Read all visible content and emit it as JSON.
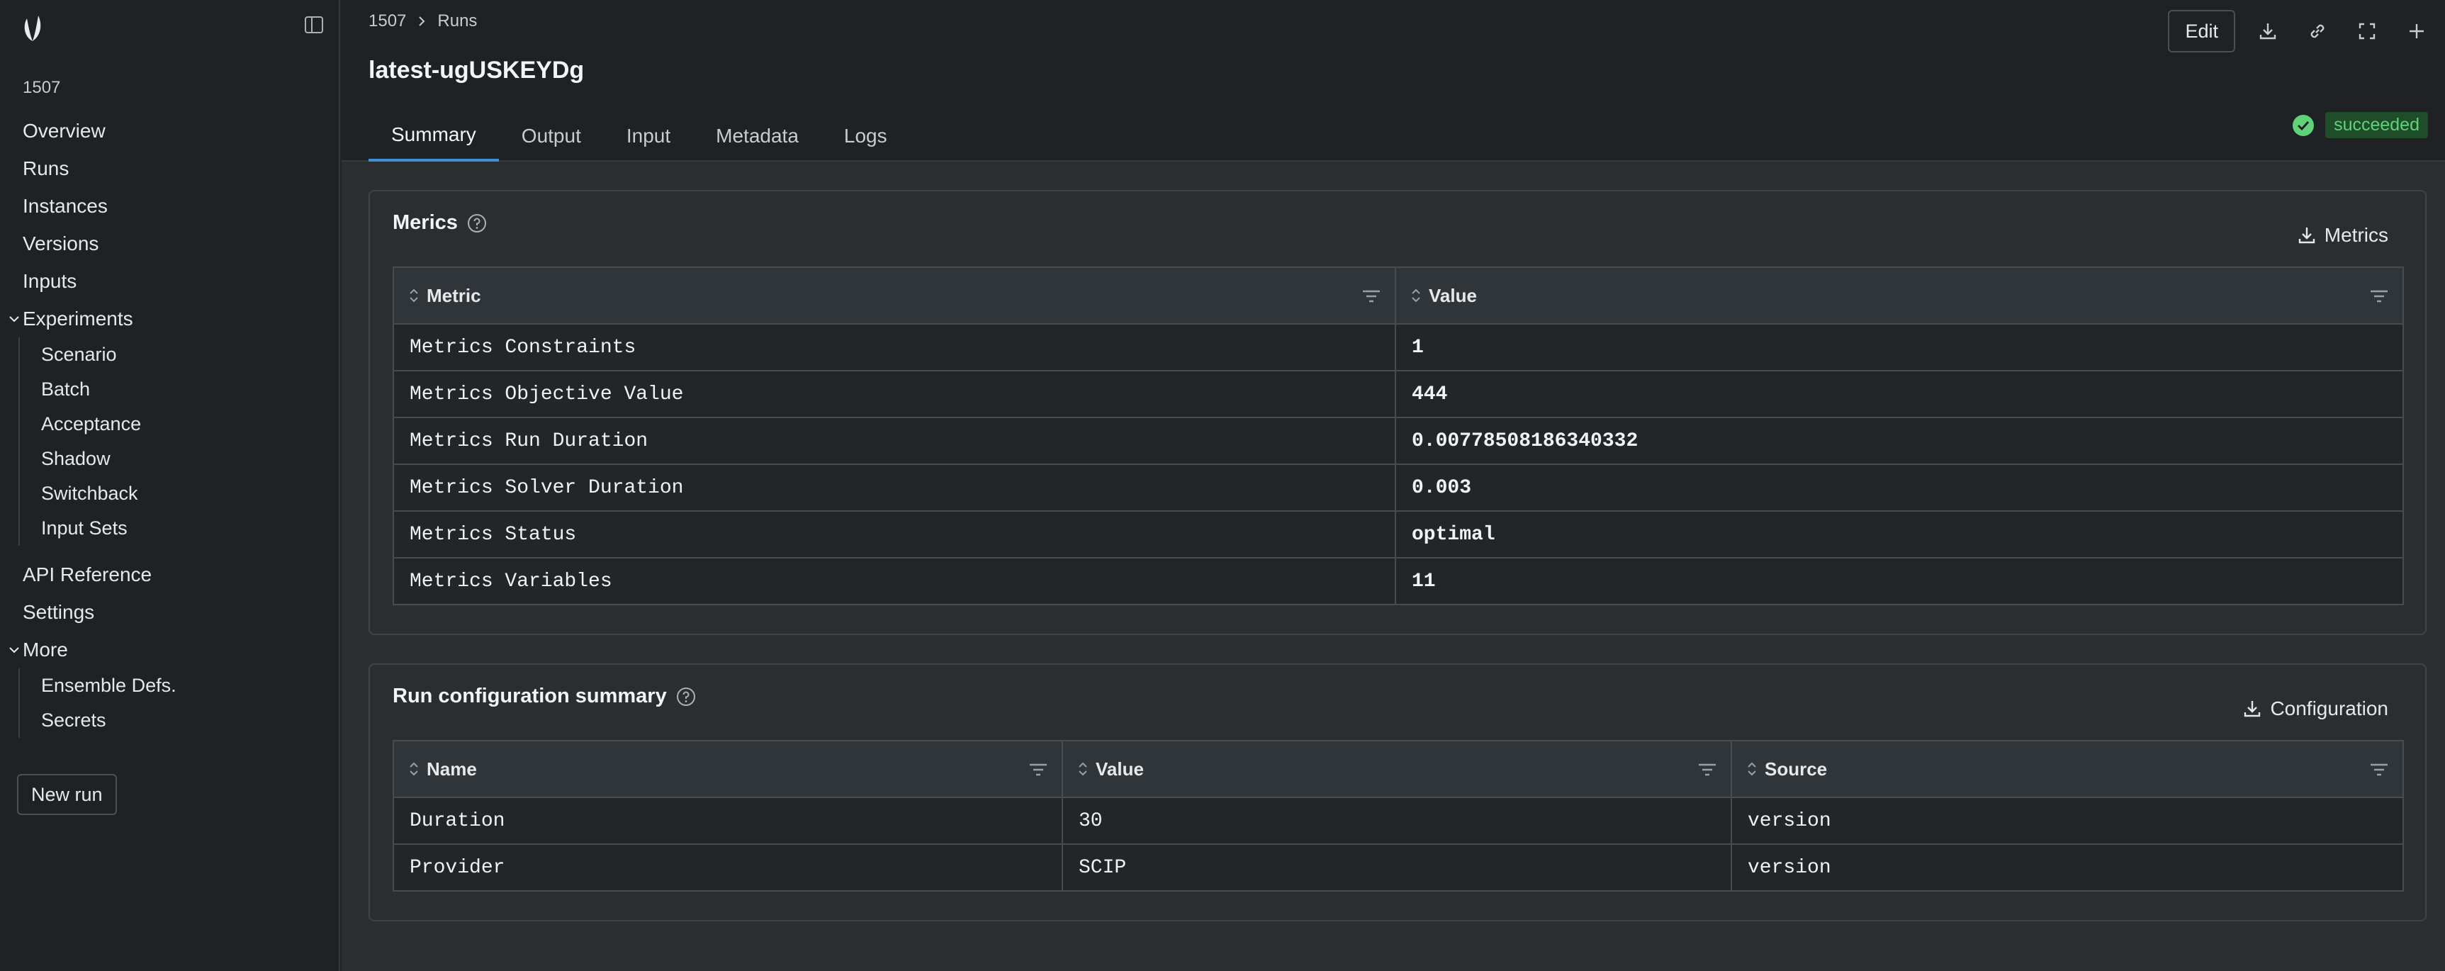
{
  "sidebar": {
    "project_id": "1507",
    "nav": [
      "Overview",
      "Runs",
      "Instances",
      "Versions",
      "Inputs"
    ],
    "experiments": {
      "label": "Experiments",
      "items": [
        "Scenario",
        "Batch",
        "Acceptance",
        "Shadow",
        "Switchback",
        "Input Sets"
      ]
    },
    "nav2": [
      "API Reference",
      "Settings"
    ],
    "more": {
      "label": "More",
      "items": [
        "Ensemble Defs.",
        "Secrets"
      ]
    },
    "new_run": "New run"
  },
  "header": {
    "breadcrumb": [
      "1507",
      "Runs"
    ],
    "title": "latest-ugUSKEYDg",
    "tabs": [
      "Summary",
      "Output",
      "Input",
      "Metadata",
      "Logs"
    ],
    "active_tab": "Summary",
    "edit": "Edit",
    "status": "succeeded"
  },
  "metrics": {
    "title": "Merics",
    "download": "Metrics",
    "columns": [
      "Metric",
      "Value"
    ],
    "rows": [
      [
        "Metrics Constraints",
        "1"
      ],
      [
        "Metrics Objective Value",
        "444"
      ],
      [
        "Metrics Run Duration",
        "0.00778508186340332"
      ],
      [
        "Metrics Solver Duration",
        "0.003"
      ],
      [
        "Metrics Status",
        "optimal"
      ],
      [
        "Metrics Variables",
        "11"
      ]
    ]
  },
  "config": {
    "title": "Run configuration summary",
    "download": "Configuration",
    "columns": [
      "Name",
      "Value",
      "Source"
    ],
    "rows": [
      [
        "Duration",
        "30",
        "version"
      ],
      [
        "Provider",
        "SCIP",
        "version"
      ]
    ]
  },
  "colors": {
    "accent": "#3f8fd9",
    "success": "#5fd27a",
    "success_bg": "#1f4d2a"
  }
}
